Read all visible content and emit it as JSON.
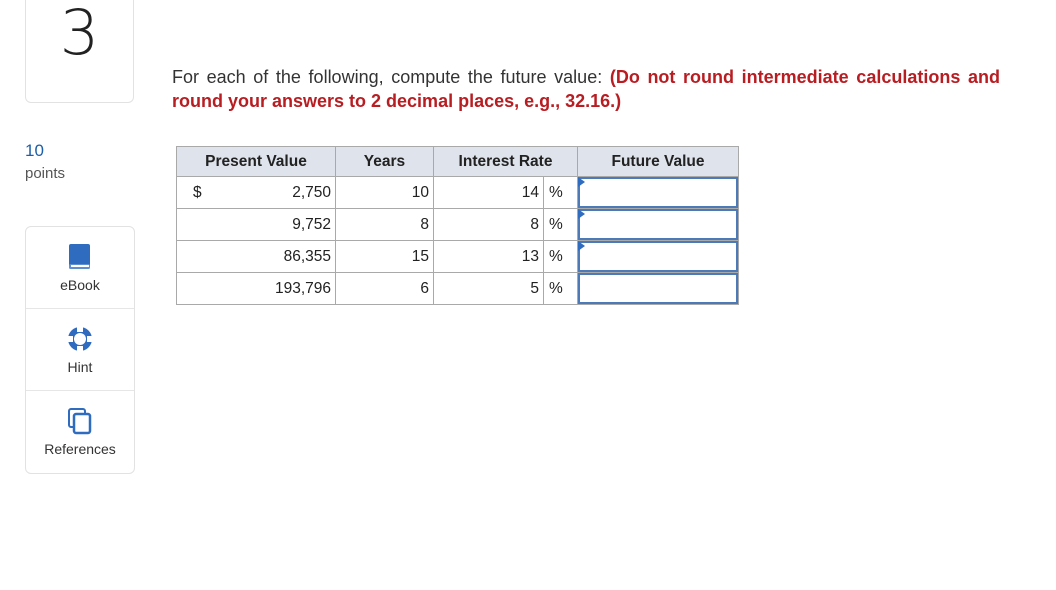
{
  "question": {
    "number": "3",
    "points_value": "10",
    "points_label": "points"
  },
  "tools": [
    {
      "label": "eBook",
      "icon": "book-icon"
    },
    {
      "label": "Hint",
      "icon": "lifebuoy-icon"
    },
    {
      "label": "References",
      "icon": "copy-pages-icon"
    }
  ],
  "instructions": {
    "text": "For each of the following, compute the future value:",
    "emphasis": "(Do not round intermediate calculations and round your answers to 2 decimal places, e.g., 32.16.)"
  },
  "table": {
    "headers": {
      "present_value": "Present Value",
      "years": "Years",
      "interest_rate": "Interest Rate",
      "future_value": "Future Value"
    },
    "currency_symbol": "$",
    "percent_symbol": "%",
    "rows": [
      {
        "present_value": "2,750",
        "years": "10",
        "rate": "14",
        "future_value": ""
      },
      {
        "present_value": "9,752",
        "years": "8",
        "rate": "8",
        "future_value": ""
      },
      {
        "present_value": "86,355",
        "years": "15",
        "rate": "13",
        "future_value": ""
      },
      {
        "present_value": "193,796",
        "years": "6",
        "rate": "5",
        "future_value": ""
      }
    ]
  },
  "colors": {
    "accent": "#1d5ea8",
    "emphasis": "#b81d22",
    "header_bg": "#dfe4ec",
    "input_border": "#4c79b8"
  }
}
